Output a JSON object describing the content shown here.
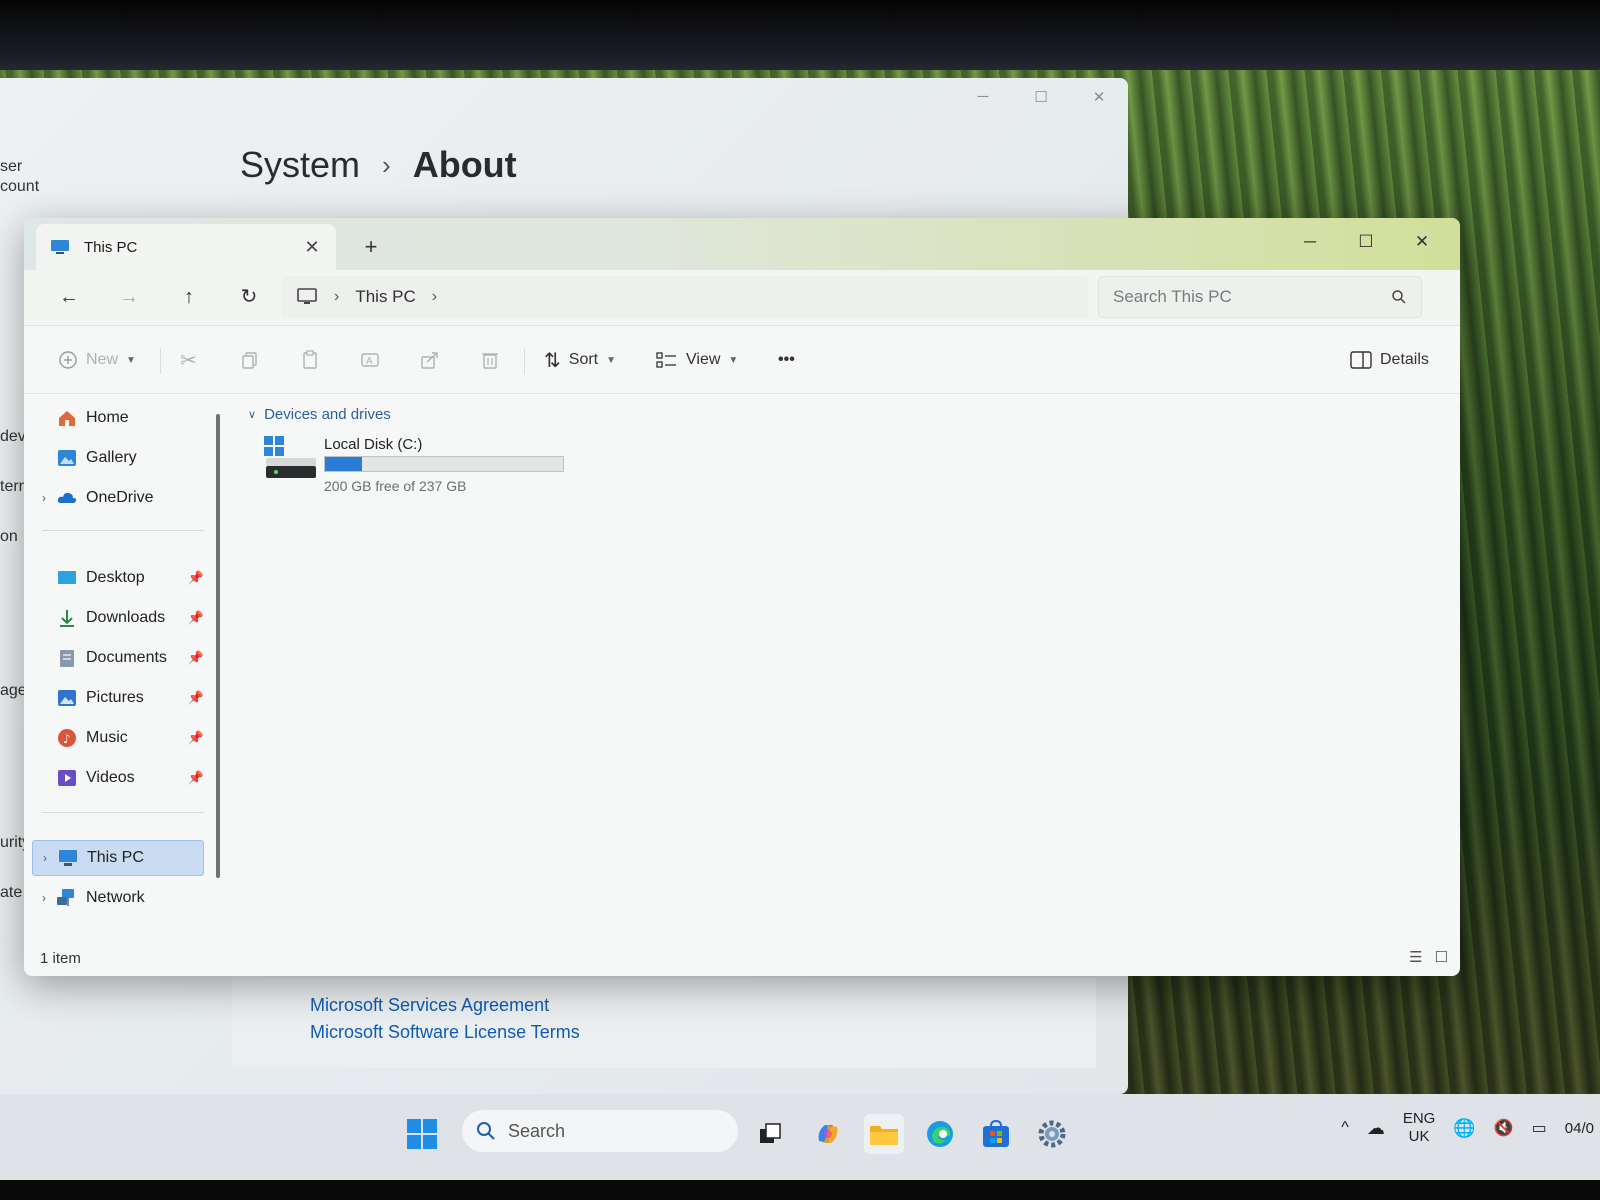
{
  "settings": {
    "breadcrumb_parent": "System",
    "breadcrumb_sep": "›",
    "breadcrumb_current": "About",
    "side_fragments": [
      "ser",
      "count",
      "devi",
      "tern",
      "on",
      "age",
      "urity",
      "ate"
    ],
    "links": [
      "Microsoft Services Agreement",
      "Microsoft Software License Terms"
    ],
    "caption": {
      "minimize": "─",
      "maximize": "☐",
      "close": "✕"
    }
  },
  "explorer": {
    "tab_title": "This PC",
    "tab_close": "✕",
    "new_tab": "+",
    "window_controls": {
      "minimize": "─",
      "maximize": "☐",
      "close": "✕"
    },
    "nav_buttons": {
      "back": "←",
      "forward": "→",
      "up": "↑",
      "refresh": "↻"
    },
    "address": {
      "chevron": "›",
      "location": "This PC"
    },
    "search": {
      "placeholder": "Search This PC"
    },
    "commands": {
      "new": "New",
      "sort": "Sort",
      "view": "View",
      "more": "•••",
      "details": "Details"
    },
    "navpane": {
      "quick": [
        {
          "label": "Home",
          "icon": "home-icon"
        },
        {
          "label": "Gallery",
          "icon": "gallery-icon"
        },
        {
          "label": "OneDrive",
          "icon": "cloud-icon"
        }
      ],
      "pinned": [
        {
          "label": "Desktop",
          "icon": "desktop-icon"
        },
        {
          "label": "Downloads",
          "icon": "download-icon"
        },
        {
          "label": "Documents",
          "icon": "documents-icon"
        },
        {
          "label": "Pictures",
          "icon": "pictures-icon"
        },
        {
          "label": "Music",
          "icon": "music-icon"
        },
        {
          "label": "Videos",
          "icon": "videos-icon"
        }
      ],
      "locations": [
        {
          "label": "This PC",
          "icon": "computer-icon",
          "selected": true
        },
        {
          "label": "Network",
          "icon": "network-icon"
        }
      ]
    },
    "group_header": "Devices and drives",
    "drives": [
      {
        "name": "Local Disk (C:)",
        "free_text": "200 GB free of 237 GB",
        "used_fraction": 0.156
      }
    ],
    "status": "1 item"
  },
  "taskbar": {
    "search_label": "Search",
    "tray": {
      "lang_line1": "ENG",
      "lang_line2": "UK",
      "clock_fragment": "04/0"
    }
  },
  "colors": {
    "accent": "#2a7bd4",
    "selection": "#c9dcf2",
    "link": "#0f5bb5"
  }
}
